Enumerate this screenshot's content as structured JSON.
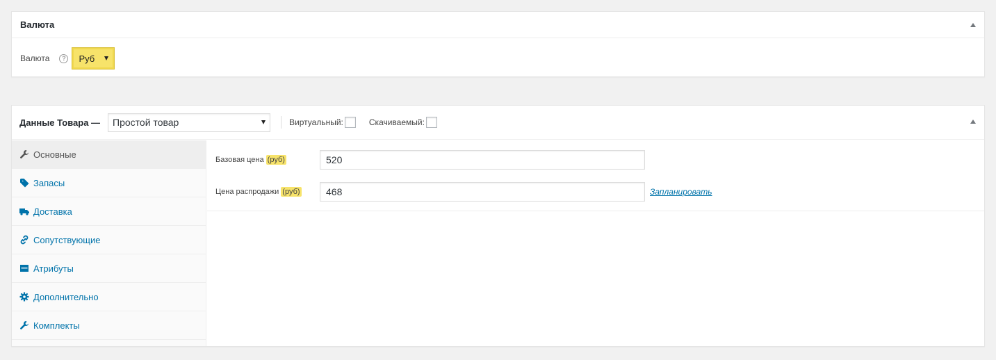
{
  "currency_box": {
    "title": "Валюта",
    "field_label": "Валюта",
    "help_glyph": "?",
    "selected": "Руб"
  },
  "product_box": {
    "title": "Данные Товара —",
    "product_type": "Простой товар",
    "virtual_label": "Виртуальный:",
    "downloadable_label": "Скачиваемый:",
    "tabs": [
      {
        "label": "Основные",
        "icon": "wrench-icon"
      },
      {
        "label": "Запасы",
        "icon": "tag-icon"
      },
      {
        "label": "Доставка",
        "icon": "truck-icon"
      },
      {
        "label": "Сопутствующие",
        "icon": "link-icon"
      },
      {
        "label": "Атрибуты",
        "icon": "list-icon"
      },
      {
        "label": "Дополнительно",
        "icon": "gear-icon"
      },
      {
        "label": "Комплекты",
        "icon": "wrench-icon"
      }
    ],
    "fields": {
      "regular_price_label": "Базовая цена",
      "regular_price_unit": "(руб)",
      "regular_price_value": "520",
      "sale_price_label": "Цена распродажи",
      "sale_price_unit": "(руб)",
      "sale_price_value": "468",
      "schedule_link": "Запланировать"
    }
  },
  "colors": {
    "highlight": "#f7e36a",
    "link": "#0073aa",
    "active_tab_bg": "#eeeeee"
  }
}
